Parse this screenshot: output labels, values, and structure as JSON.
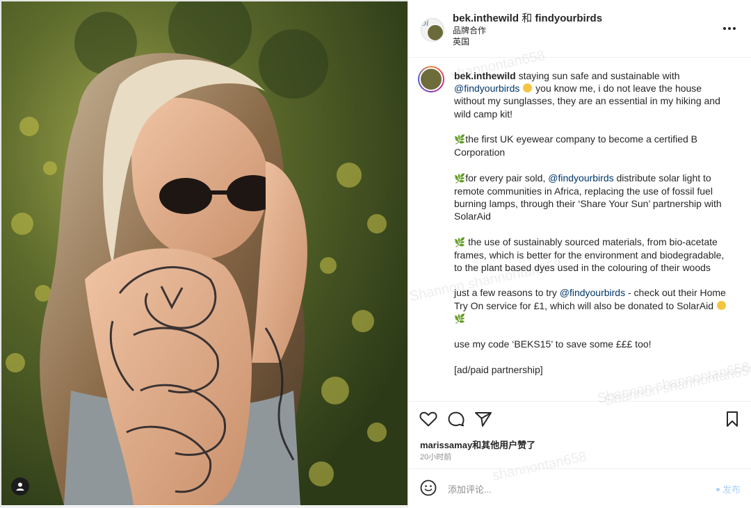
{
  "header": {
    "username": "bek.inthewild",
    "connector": "和",
    "partner": "findyourbirds",
    "subtitle": "品牌合作",
    "location": "英国",
    "avatar_badge": "bi"
  },
  "caption": {
    "username": "bek.inthewild",
    "p1_a": "staying sun safe and sustainable with",
    "p1_mention": "@findyourbirds",
    "p1_b": "you know me, i do not leave the house without my sunglasses, they are an essential in my hiking and wild camp kit!",
    "p2": "the first UK eyewear company to become a certified B Corporation",
    "p3_a": "for every pair sold,",
    "p3_mention": "@findyourbirds",
    "p3_b": "distribute solar light to remote communities in Africa, replacing the use of fossil fuel burning lamps, through their ‘Share Your Sun’ partnership with SolarAid",
    "p4": "the use of sustainably sourced materials, from bio-acetate frames, which is better for the environment and biodegradable, to the plant based dyes used in the colouring of their woods",
    "p5_a": "just a few reasons to try",
    "p5_mention": "@findyourbirds",
    "p5_b": "- check out their Home Try On service for £1, which will also be donated to SolarAid",
    "p6": "use my code ‘BEKS15’ to save some £££ too!",
    "p7": "[ad/paid partnership]"
  },
  "watermarks": [
    "shannontan658",
    "Shannon shannontan658",
    "Shannon shannontan658",
    "shannontan658",
    "Shannon shannontan658"
  ],
  "likes": {
    "text": "marissamay和其他用户赞了",
    "time": "20小时前"
  },
  "comment": {
    "placeholder": "添加评论...",
    "post_label": "发布"
  },
  "colors": {
    "mention": "#00376b",
    "post_button": "#a9d2f5",
    "leaf": "#4f9a2f"
  },
  "icons": {
    "like": "heart-icon",
    "comment": "comment-icon",
    "share": "share-icon",
    "save": "bookmark-icon",
    "more": "more-horizontal-icon",
    "emoji": "smile-icon",
    "user": "user-tag-icon"
  }
}
